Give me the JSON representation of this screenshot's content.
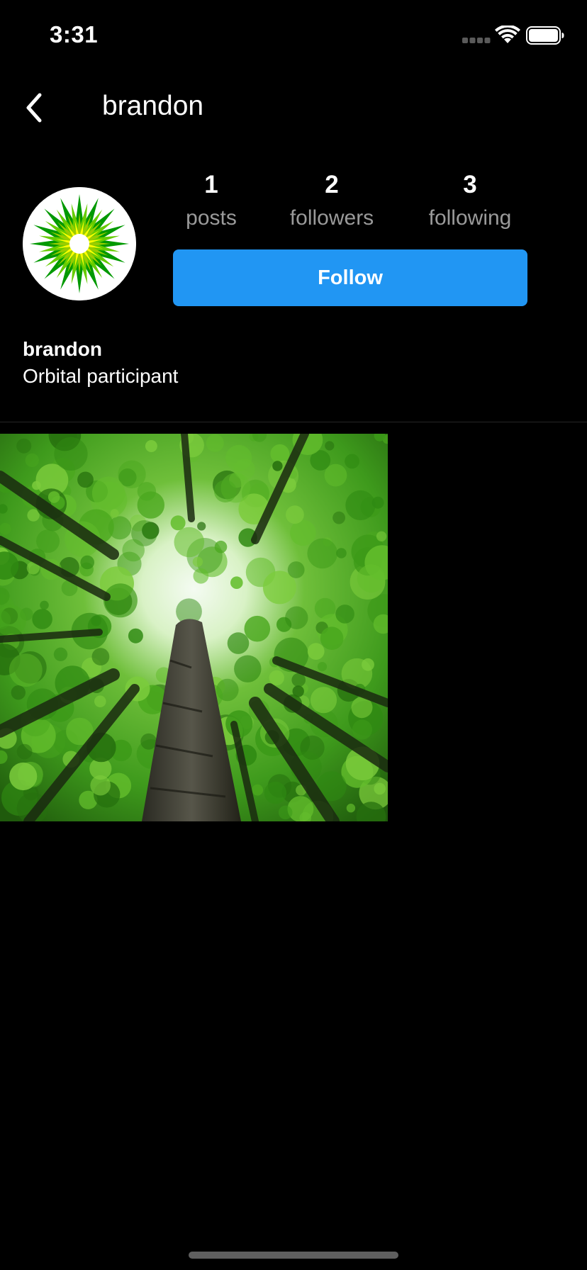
{
  "status_bar": {
    "time": "3:31"
  },
  "header": {
    "back_icon": "chevron-left-icon",
    "title": "brandon"
  },
  "profile": {
    "avatar_icon": "green-starburst-logo",
    "stats": [
      {
        "value": "1",
        "label": "posts"
      },
      {
        "value": "2",
        "label": "followers"
      },
      {
        "value": "3",
        "label": "following"
      }
    ],
    "follow_label": "Follow",
    "name": "brandon",
    "bio": "Orbital participant"
  },
  "posts": [
    {
      "description_icon": "forest-canopy-photo"
    }
  ],
  "colors": {
    "background": "#000000",
    "follow_button": "#2196f3",
    "stat_label": "#9a9a9a",
    "divider": "#262626"
  }
}
